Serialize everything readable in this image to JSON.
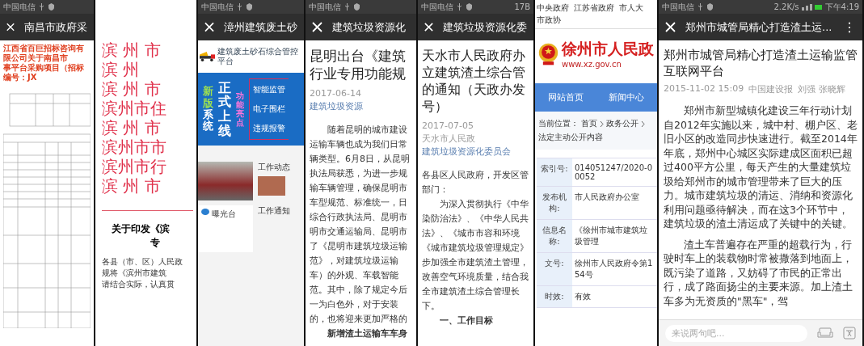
{
  "panels": [
    {
      "kind": "doc",
      "status": {
        "carrier": "中国电信"
      },
      "title": "南昌市政府采",
      "headings": [
        "江西省百巨招标咨询有限公司关于南昌市",
        "事平台采购项目（招标编号：JX"
      ]
    },
    {
      "kind": "notice",
      "red_lines": [
        "滨 州 市",
        "滨 州",
        "滨 州 市",
        "滨州市住",
        "滨 州 市",
        "滨州市市",
        "滨州市行",
        "滨 州 市"
      ],
      "notice_title": "关于印发《滨",
      "notice_title2": "专",
      "paragraph_lines": [
        "各县（市、区）人民政",
        "规将《滨州市建筑",
        "请结合实际，认真贯"
      ]
    },
    {
      "kind": "portal",
      "status": {
        "carrier": "中国电信"
      },
      "title": "漳州建筑废土砂",
      "platform_name": "建筑废土砂石综合管控平台",
      "banner": {
        "new_label": "新版",
        "system_label": "系统",
        "launch_label": "正式上线",
        "features_label": "功能亮点",
        "features": [
          "智能监管",
          "电子围栏",
          "违规报警"
        ]
      },
      "sections": [
        {
          "title": "工作动态"
        },
        {
          "title": "曝光台"
        },
        {
          "title": "工作通知"
        }
      ]
    },
    {
      "kind": "article",
      "status": {
        "carrier": "中国电信"
      },
      "title": "建筑垃圾资源化",
      "headline_lines": [
        "昆明出台《建筑",
        "行业专用功能规"
      ],
      "meta": {
        "date": "2017-06-14",
        "source": "建筑垃圾资源"
      },
      "body_lines": [
        {
          "text": "随着昆明的城市建设",
          "indent": true
        },
        {
          "text": "运输车辆也成为我们日常",
          "indent": false
        },
        {
          "text": "辆类型。6月8日，从昆明",
          "indent": false
        },
        {
          "text": "执法局获悉，为进一步规",
          "indent": false
        },
        {
          "text": "输车辆管理，确保昆明市",
          "indent": false
        },
        {
          "text": "车型规范、标准统一，日",
          "indent": false
        },
        {
          "text": "综合行政执法局、昆明市",
          "indent": false
        },
        {
          "text": "明市交通运输局、昆明市",
          "indent": false
        },
        {
          "text": "了《昆明市建筑垃圾运输",
          "indent": false
        },
        {
          "text": "范》，对建筑垃圾运输",
          "indent": false
        },
        {
          "text": "车）的外观、车载智能",
          "indent": false
        },
        {
          "text": "范。其中，除了规定今后",
          "indent": false
        },
        {
          "text": "一为白色外，对于安装",
          "indent": false
        },
        {
          "text": "的，也将迎来更加严格的",
          "indent": false
        }
      ],
      "subheading": "新增渣土运输车车身"
    },
    {
      "kind": "article",
      "status": {
        "carrier": "中国电信",
        "extra": "17B"
      },
      "title": "建筑垃圾资源化委",
      "headline_lines": [
        "天水市人民政府办",
        "立建筑渣土综合管",
        "的通知（天政办发",
        "号）"
      ],
      "meta": {
        "date": "2017-07-05",
        "author": "天水市人民政",
        "source": "建筑垃圾资源化委员会"
      },
      "body_lines": [
        {
          "text": "各县区人民政府，开发区管",
          "indent": false
        },
        {
          "text": "部门：",
          "indent": false
        },
        {
          "text": "为深入贯彻执行《中华",
          "indent": true
        },
        {
          "text": "染防治法》、《中华人民共",
          "indent": false
        },
        {
          "text": "法》、《城市市容和环境",
          "indent": false
        },
        {
          "text": "《城市建筑垃圾管理规定》",
          "indent": false
        },
        {
          "text": "步加强全市建筑渣土管理，",
          "indent": false
        },
        {
          "text": "改善空气环境质量，结合我",
          "indent": false
        },
        {
          "text": "全市建筑渣土综合管理长",
          "indent": false
        },
        {
          "text": "下。",
          "indent": false
        }
      ],
      "subheading": "一、工作目标"
    },
    {
      "kind": "gov",
      "top_links": [
        "中央政府",
        "江苏省政府",
        "市人大",
        "市政协"
      ],
      "site_name": "徐州市人民政",
      "url": "www.xz.gov.cn",
      "nav": [
        {
          "label": "网站首页",
          "selected": false
        },
        {
          "label": "新闻中心",
          "selected": false
        }
      ],
      "breadcrumb": {
        "label": "当前位置：",
        "items": [
          "首页",
          "政务公开",
          "法定主动公开内容"
        ]
      },
      "info_rows": [
        {
          "label": "索引号:",
          "value": "014051247/2020-00052"
        },
        {
          "label": "发布机构:",
          "value": "市人民政府办公室"
        },
        {
          "label": "信息名称:",
          "value": "《徐州市城市建筑垃圾管理"
        },
        {
          "label": "文号:",
          "value": "徐州市人民政府令第154号"
        },
        {
          "label": "时效:",
          "value": "有效"
        }
      ]
    },
    {
      "kind": "wechat",
      "status": {
        "carrier": "中国电信",
        "speed": "2.2K/s",
        "time": "下午4:19"
      },
      "title": "郑州市城管局精心打造渣土运...",
      "more": "⋮",
      "headline": "郑州市城管局精心打造渣土运输监管互联网平台",
      "meta": {
        "date": "2015-11-02 15:09",
        "source": "中国建设报",
        "author": "刘强 张晓辉"
      },
      "paragraphs": [
        "郑州市新型城镇化建设三年行动计划自2012年实施以来，城中村、棚户区、老旧小区的改造同步快速进行。截至2014年年底，郑州中心城区实际建成区面积已超过400平方公里，每天产生的大量建筑垃圾给郑州市的城市管理带来了巨大的压力。城市建筑垃圾的清运、消纳和资源化利用问题亟待解决，而在这3个环节中，建筑垃圾的渣土清运成了关键中的关键。",
        "渣土车普遍存在严重的超载行为，行驶时车上的装载物时常被撒落到地面上，既污染了道路，又妨碍了市民的正常出行，成了路面扬尘的主要来源。加上渣土车多为无资质的\"黑车\"，驾"
      ],
      "comment": {
        "placeholder": "来说两句吧..."
      }
    }
  ]
}
